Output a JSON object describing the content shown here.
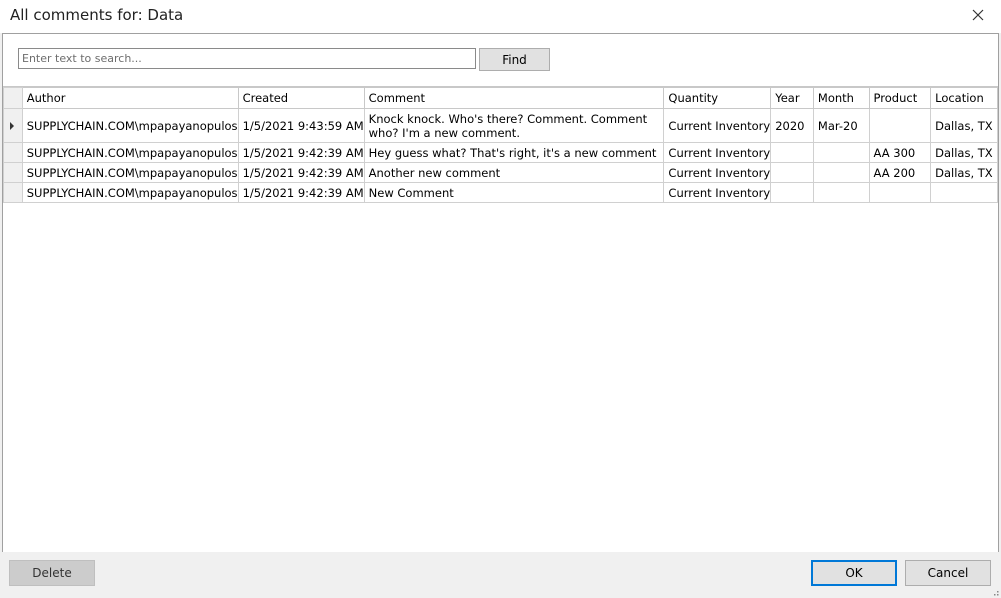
{
  "window": {
    "title": "All comments for: Data"
  },
  "search": {
    "placeholder": "Enter text to search...",
    "value": "",
    "find_label": "Find"
  },
  "table": {
    "headers": [
      "Author",
      "Created",
      "Comment",
      "Quantity",
      "Year",
      "Month",
      "Product",
      "Location"
    ],
    "rows": [
      [
        "SUPPLYCHAIN.COM\\mpapayanopulos",
        "1/5/2021 9:43:59 AM",
        "Knock knock. Who's there? Comment. Comment who? I'm a new comment.",
        "Current Inventory",
        "2020",
        "Mar-20",
        "",
        "Dallas, TX"
      ],
      [
        "SUPPLYCHAIN.COM\\mpapayanopulos",
        "1/5/2021 9:42:39 AM",
        "Hey guess what? That's right, it's a new comment",
        "Current Inventory",
        "",
        "",
        "AA 300",
        "Dallas, TX"
      ],
      [
        "SUPPLYCHAIN.COM\\mpapayanopulos",
        "1/5/2021 9:42:39 AM",
        "Another new comment",
        "Current Inventory",
        "",
        "",
        "AA 200",
        "Dallas, TX"
      ],
      [
        "SUPPLYCHAIN.COM\\mpapayanopulos",
        "1/5/2021 9:42:39 AM",
        "New Comment",
        "Current Inventory",
        "",
        "",
        "",
        ""
      ]
    ]
  },
  "footer": {
    "delete_label": "Delete",
    "ok_label": "OK",
    "cancel_label": "Cancel"
  },
  "colors": {
    "accent": "#0078d7",
    "panel_border": "#a0a0a0",
    "dialog_bg": "#f0f0f0"
  },
  "icons": {
    "close": "close-icon",
    "row_indicator": "row-indicator-arrow-icon",
    "resize": "resize-grip-icon"
  }
}
